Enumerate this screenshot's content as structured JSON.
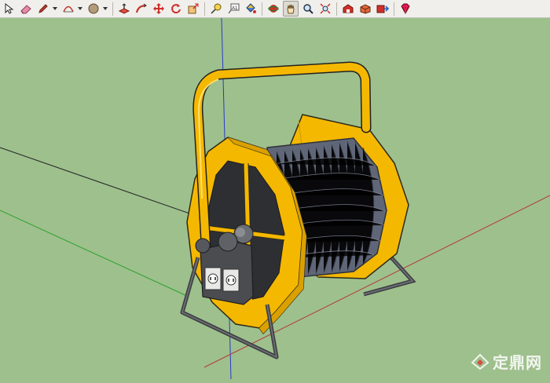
{
  "toolbar": {
    "tools": [
      {
        "name": "select-tool",
        "icon": "arrow-icon",
        "group": 1
      },
      {
        "name": "eraser-tool",
        "icon": "eraser-icon",
        "group": 1
      },
      {
        "name": "pencil-tool",
        "icon": "pencil-icon",
        "group": 1,
        "dropdown": true
      },
      {
        "name": "arc-tool",
        "icon": "arc-icon",
        "group": 1,
        "dropdown": true
      },
      {
        "name": "shape-tool",
        "icon": "circle-icon",
        "group": 1,
        "dropdown": true
      },
      {
        "name": "push-pull-tool",
        "icon": "push-pull-icon",
        "group": 2
      },
      {
        "name": "follow-me-tool",
        "icon": "follow-me-icon",
        "group": 2
      },
      {
        "name": "move-tool",
        "icon": "move-icon",
        "group": 2
      },
      {
        "name": "rotate-tool",
        "icon": "rotate-icon",
        "group": 2
      },
      {
        "name": "scale-tool",
        "icon": "scale-icon",
        "group": 2
      },
      {
        "name": "tape-measure-tool",
        "icon": "tape-measure-icon",
        "group": 3
      },
      {
        "name": "text-tool",
        "icon": "text-icon",
        "group": 3,
        "label": "A1"
      },
      {
        "name": "paint-bucket-tool",
        "icon": "paint-bucket-icon",
        "group": 3
      },
      {
        "name": "orbit-tool",
        "icon": "orbit-icon",
        "group": 4
      },
      {
        "name": "pan-tool",
        "icon": "pan-icon",
        "group": 4,
        "active": true
      },
      {
        "name": "zoom-tool",
        "icon": "zoom-icon",
        "group": 4
      },
      {
        "name": "zoom-extents-tool",
        "icon": "zoom-extents-icon",
        "group": 4
      },
      {
        "name": "warehouse-tool",
        "icon": "warehouse-icon",
        "group": 5
      },
      {
        "name": "share-model-tool",
        "icon": "share-model-icon",
        "group": 5
      },
      {
        "name": "extension-warehouse-tool",
        "icon": "extension-icon",
        "group": 5
      },
      {
        "name": "ruby-console-tool",
        "icon": "ruby-icon",
        "group": 6
      }
    ]
  },
  "watermark": {
    "text": "定鼎网"
  },
  "colors": {
    "background": "#9ec08d",
    "reel_yellow": "#f5b800",
    "cable": "#5f6677",
    "frame": "#5a5d62"
  }
}
